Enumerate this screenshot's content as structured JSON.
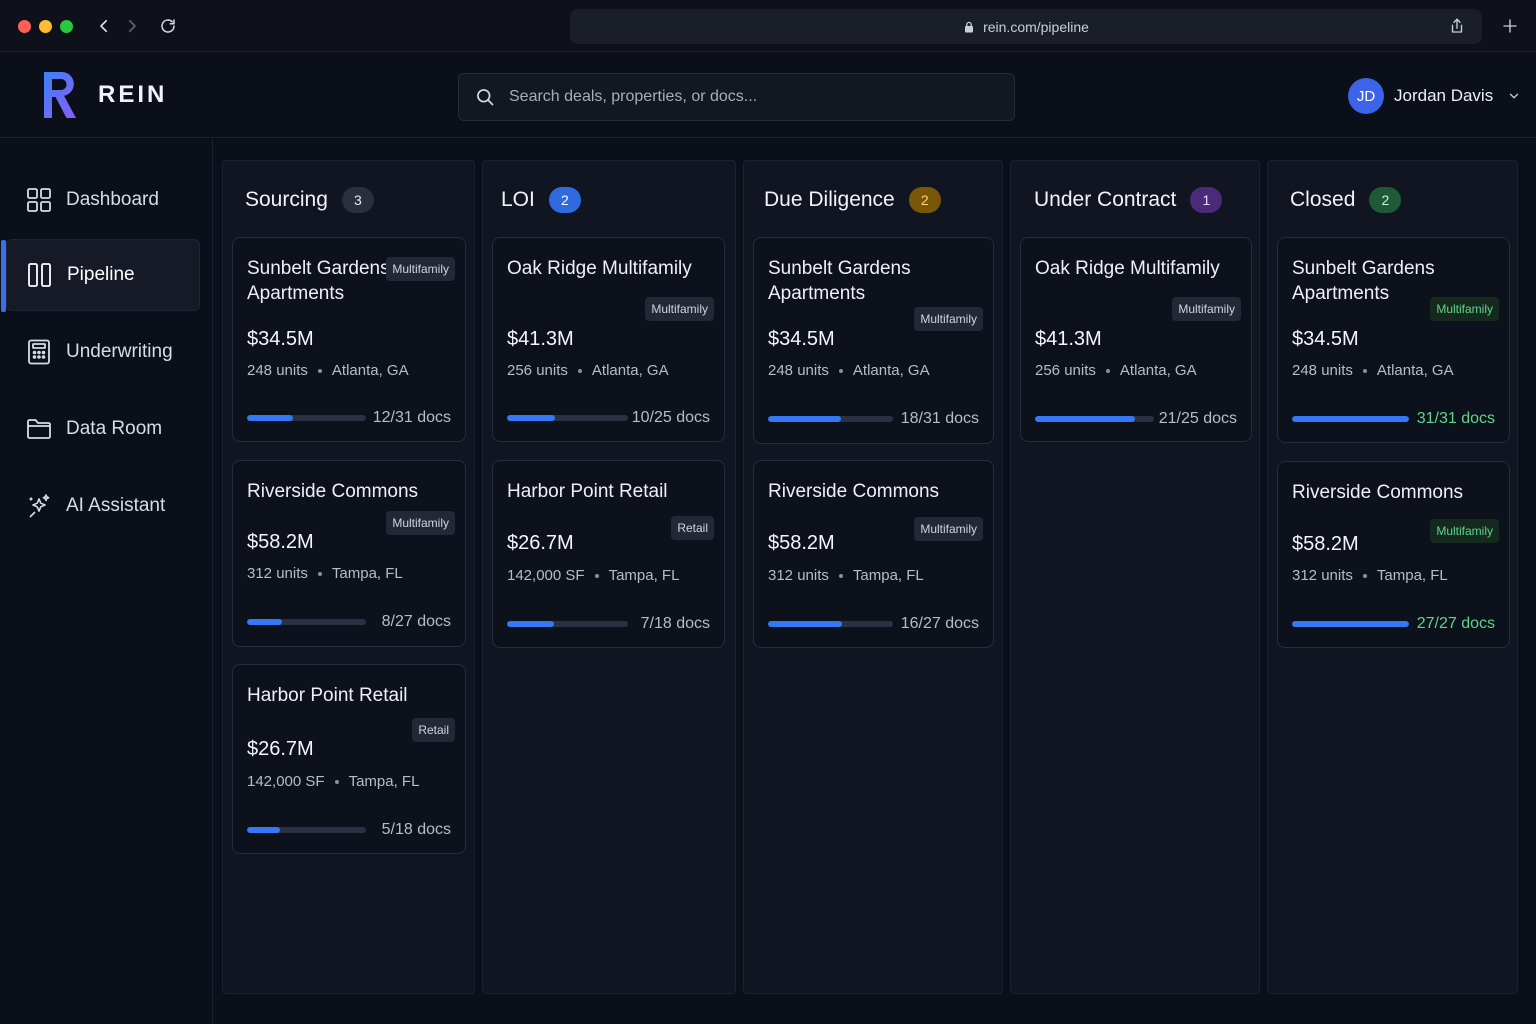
{
  "browser": {
    "url": "rein.com/pipeline"
  },
  "app": {
    "logo_text": "REIN"
  },
  "search": {
    "placeholder": "Search deals, properties, or docs..."
  },
  "user": {
    "initials": "JD",
    "name": "Jordan Davis"
  },
  "sidebar": {
    "items": [
      {
        "label": "Dashboard"
      },
      {
        "label": "Pipeline"
      },
      {
        "label": "Underwriting"
      },
      {
        "label": "Data Room"
      },
      {
        "label": "AI Assistant"
      }
    ]
  },
  "colors": {
    "accent": "#3478f6",
    "sourcing_badge": "#2a2f3d",
    "loi_badge": "#2f6ae0",
    "dd_badge": "#7a5708",
    "uc_badge": "#4b2a7a",
    "closed_badge": "#1d5a35",
    "success": "#5fd48a"
  },
  "columns": [
    {
      "title": "Sourcing",
      "count": "3",
      "cards": [
        {
          "name_lines": [
            "Sunbelt Gardens",
            "Apartments"
          ],
          "tag": "Multifamily",
          "price": "$34.5M",
          "size": "248 units",
          "location": "Atlanta, GA",
          "docs": "12/31 docs",
          "progress": 0.387
        },
        {
          "name_lines": [
            "Riverside Commons"
          ],
          "tag": "Multifamily",
          "price": "$58.2M",
          "size": "312 units",
          "location": "Tampa, FL",
          "docs": "8/27 docs",
          "progress": 0.296
        },
        {
          "name_lines": [
            "Harbor Point Retail"
          ],
          "tag": "Retail",
          "price": "$26.7M",
          "size": "142,000 SF",
          "location": "Tampa, FL",
          "docs": "5/18 docs",
          "progress": 0.278
        }
      ]
    },
    {
      "title": "LOI",
      "count": "2",
      "cards": [
        {
          "name_lines": [
            "Oak Ridge Multifamily"
          ],
          "tag": "Multifamily",
          "price": "$41.3M",
          "size": "256 units",
          "location": "Atlanta, GA",
          "docs": "10/25 docs",
          "progress": 0.4
        },
        {
          "name_lines": [
            "Harbor Point Retail"
          ],
          "tag": "Retail",
          "price": "$26.7M",
          "size": "142,000 SF",
          "location": "Tampa, FL",
          "docs": "7/18 docs",
          "progress": 0.389
        }
      ]
    },
    {
      "title": "Due Diligence",
      "count": "2",
      "cards": [
        {
          "name_lines": [
            "Sunbelt Gardens",
            "Apartments"
          ],
          "tag": "Multifamily",
          "price": "$34.5M",
          "size": "248 units",
          "location": "Atlanta, GA",
          "docs": "18/31 docs",
          "progress": 0.581
        },
        {
          "name_lines": [
            "Riverside Commons"
          ],
          "tag": "Multifamily",
          "price": "$58.2M",
          "size": "312 units",
          "location": "Tampa, FL",
          "docs": "16/27 docs",
          "progress": 0.593
        }
      ]
    },
    {
      "title": "Under Contract",
      "count": "1",
      "cards": [
        {
          "name_lines": [
            "Oak Ridge Multifamily"
          ],
          "tag": "Multifamily",
          "price": "$41.3M",
          "size": "256 units",
          "location": "Atlanta, GA",
          "docs": "21/25 docs",
          "progress": 0.84
        }
      ]
    },
    {
      "title": "Closed",
      "count": "2",
      "cards": [
        {
          "name_lines": [
            "Sunbelt Gardens",
            "Apartments"
          ],
          "tag": "Multifamily",
          "price": "$34.5M",
          "size": "248 units",
          "location": "Atlanta, GA",
          "docs": "31/31 docs",
          "progress": 1.0
        },
        {
          "name_lines": [
            "Riverside Commons"
          ],
          "tag": "Multifamily",
          "price": "$58.2M",
          "size": "312 units",
          "location": "Tampa, FL",
          "docs": "27/27 docs",
          "progress": 1.0
        }
      ]
    }
  ]
}
